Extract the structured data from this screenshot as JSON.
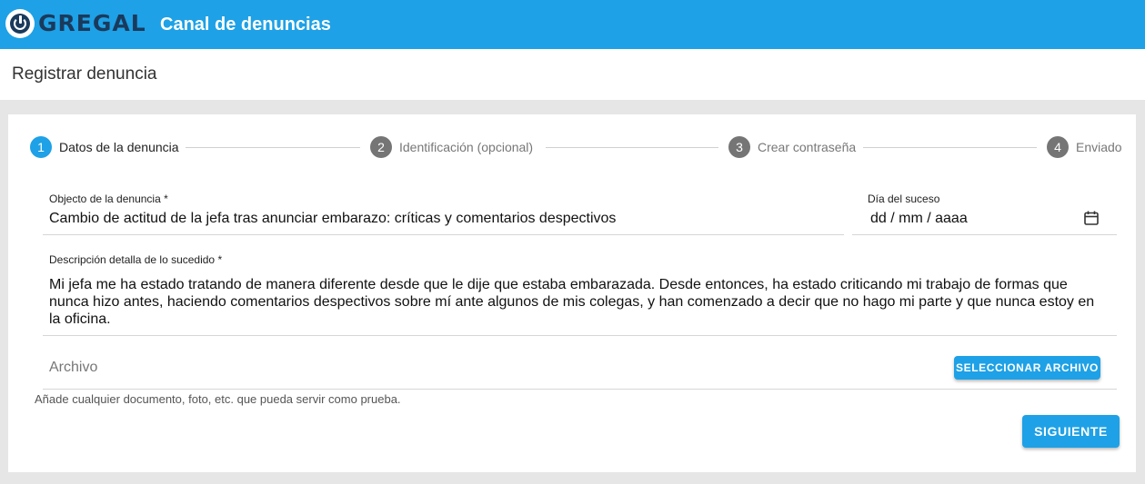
{
  "header": {
    "logo_text": "GREGAL",
    "title": "Canal de denuncias",
    "color": "#1ea1e6"
  },
  "page": {
    "title": "Registrar denuncia"
  },
  "stepper": {
    "steps": [
      {
        "number": "1",
        "label": "Datos de la denuncia",
        "state": "active"
      },
      {
        "number": "2",
        "label": "Identificación (opcional)",
        "state": "inactive"
      },
      {
        "number": "3",
        "label": "Crear contraseña",
        "state": "inactive"
      },
      {
        "number": "4",
        "label": "Enviado",
        "state": "inactive"
      }
    ],
    "active_color": "#1ea1e6",
    "inactive_color": "#757575"
  },
  "form": {
    "subject": {
      "label": "Objecto de la denuncia *",
      "value": "Cambio de actitud de la jefa tras anunciar embarazo: críticas y comentarios despectivos"
    },
    "date": {
      "label": "Día del suceso",
      "placeholder": "dd / mm / aaaa",
      "icon": "calendar-icon"
    },
    "description": {
      "label": "Descripción detalla de lo sucedido *",
      "lines": [
        "Mi jefa me ha estado tratando de manera diferente desde que le dije que estaba embarazada. Desde entonces, ha estado criticando mi trabajo de formas que",
        "nunca hizo antes, haciendo comentarios despectivos sobre mí ante algunos de mis colegas, y han comenzado a decir que no hago mi parte y que nunca estoy en",
        "la oficina."
      ]
    },
    "file": {
      "label": "Archivo",
      "button_label": "SELECCIONAR ARCHIVO",
      "hint": "Añade cualquier documento, foto, etc. que pueda servir como prueba."
    },
    "next_button_label": "SIGUIENTE"
  }
}
